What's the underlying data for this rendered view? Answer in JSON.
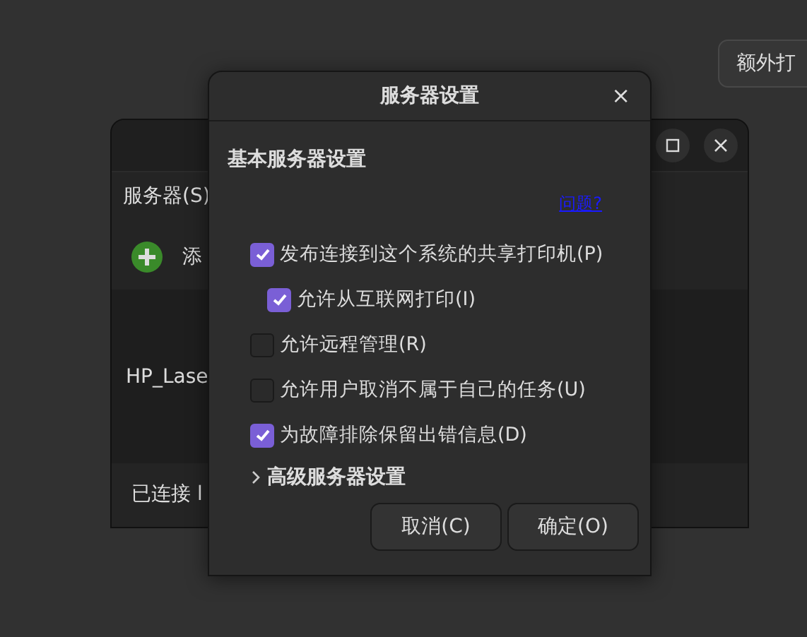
{
  "extra_button": {
    "label": "额外打"
  },
  "back_window": {
    "menu": "服务器(S)",
    "add_label": "添",
    "printer": "HP_Lase",
    "status": "已连接 l"
  },
  "dialog": {
    "title": "服务器设置",
    "close": "×",
    "section": "基本服务器设置",
    "help_link": "问题?",
    "options": [
      {
        "label": "发布连接到这个系统的共享打印机(P)",
        "checked": true,
        "children": [
          {
            "label": "允许从互联网打印(I)",
            "checked": true
          }
        ]
      },
      {
        "label": "允许远程管理(R)",
        "checked": false
      },
      {
        "label": "允许用户取消不属于自己的任务(U)",
        "checked": false
      },
      {
        "label": "为故障排除保留出错信息(D)",
        "checked": true
      }
    ],
    "advanced": {
      "label": "高级服务器设置",
      "expanded": false
    },
    "buttons": [
      "取消(C)",
      "确定(O)"
    ]
  }
}
